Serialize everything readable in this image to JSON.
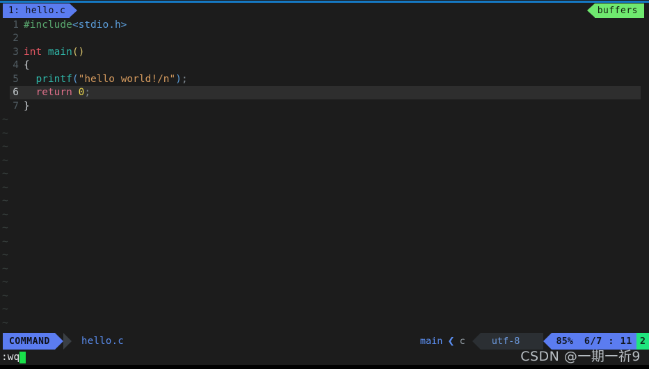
{
  "window": {
    "accent_color": "#1579c4",
    "background": "#1c1c1c"
  },
  "tabline": {
    "active_tab_label": "1: hello.c",
    "active_tab_color": "#5b7cf0",
    "buffers_label": "buffers",
    "buffers_color": "#6fe96f"
  },
  "editor": {
    "lines": [
      {
        "number": "1",
        "current": false,
        "tokens": [
          {
            "text": "#include",
            "cls": "s-pp"
          },
          {
            "text": "<stdio.h>",
            "cls": "s-inc"
          }
        ]
      },
      {
        "number": "2",
        "current": false,
        "tokens": []
      },
      {
        "number": "3",
        "current": false,
        "tokens": [
          {
            "text": "int ",
            "cls": "s-type"
          },
          {
            "text": "main",
            "cls": "s-fn"
          },
          {
            "text": "()",
            "cls": "s-paren"
          }
        ]
      },
      {
        "number": "4",
        "current": false,
        "tokens": [
          {
            "text": "{",
            "cls": "s-brace"
          }
        ]
      },
      {
        "number": "5",
        "current": false,
        "tokens": [
          {
            "text": "  ",
            "cls": "s-plain"
          },
          {
            "text": "printf",
            "cls": "s-fn"
          },
          {
            "text": "(",
            "cls": "s-inc"
          },
          {
            "text": "\"hello world!/n\"",
            "cls": "s-str"
          },
          {
            "text": ")",
            "cls": "s-inc"
          },
          {
            "text": ";",
            "cls": "s-punct"
          }
        ]
      },
      {
        "number": "6",
        "current": true,
        "tokens": [
          {
            "text": "  ",
            "cls": "s-plain"
          },
          {
            "text": "return ",
            "cls": "s-kw"
          },
          {
            "text": "0",
            "cls": "s-num"
          },
          {
            "text": ";",
            "cls": "s-punct"
          }
        ]
      },
      {
        "number": "7",
        "current": false,
        "tokens": [
          {
            "text": "}",
            "cls": "s-brace"
          }
        ]
      }
    ],
    "empty_marker": "~",
    "empty_line_count": 17,
    "current_line_bg": "#2e2e2e"
  },
  "statusline": {
    "mode": "COMMAND",
    "mode_color": "#5b7cf0",
    "filename": "hello.c",
    "branch": "main",
    "separator_icon": "chevron-left-icon",
    "filetype": "c",
    "encoding": "utf-8",
    "scroll_percent": "85%",
    "position": "6/7 : 11",
    "marker": "2",
    "marker_color": "#20e57e"
  },
  "commandline": {
    "text": ":wq",
    "cursor_color": "#19e04a"
  },
  "watermark": {
    "text": "CSDN @一期一祈9"
  }
}
